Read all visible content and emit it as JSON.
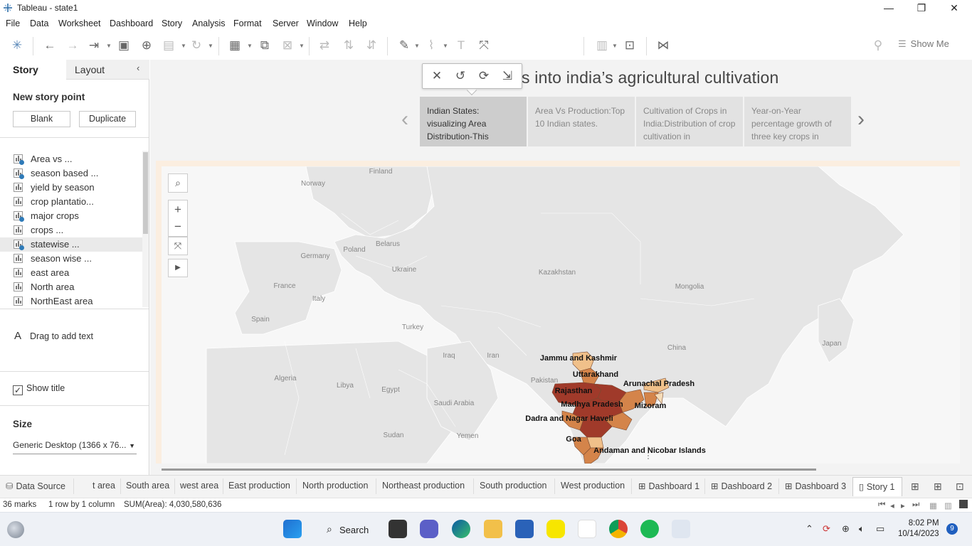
{
  "window": {
    "title": "Tableau - state1",
    "minimize": "—",
    "restore": "❐",
    "close": "✕"
  },
  "menu": [
    "File",
    "Data",
    "Worksheet",
    "Dashboard",
    "Story",
    "Analysis",
    "Format",
    "Server",
    "Window",
    "Help"
  ],
  "toolbar": {
    "show_me_label": "Show Me"
  },
  "left_panel": {
    "tabs": {
      "story": "Story",
      "layout": "Layout"
    },
    "new_story_point": "New story point",
    "blank_button": "Blank",
    "duplicate_button": "Duplicate",
    "sheets": [
      {
        "label": "Area vs ...",
        "type": "dashboard"
      },
      {
        "label": "season based ...",
        "type": "dashboard"
      },
      {
        "label": "yield by season",
        "type": "sheet"
      },
      {
        "label": "crop plantatio...",
        "type": "sheet"
      },
      {
        "label": "major crops",
        "type": "dashboard"
      },
      {
        "label": "crops ...",
        "type": "sheet"
      },
      {
        "label": "statewise ...",
        "type": "dashboard",
        "selected": true
      },
      {
        "label": "season wise ...",
        "type": "sheet"
      },
      {
        "label": "east area",
        "type": "sheet"
      },
      {
        "label": "North area",
        "type": "sheet"
      },
      {
        "label": "NorthEast area",
        "type": "sheet"
      }
    ],
    "drag_to_add_text": "Drag to add text",
    "drag_icon": "A",
    "show_title": "Show title",
    "size_header": "Size",
    "size_value": "Generic Desktop (1366 x 76..."
  },
  "story": {
    "title": "s into india’s agricultural cultivation",
    "points": [
      {
        "text": "Indian States: visualizing Area Distribution-This",
        "active": true
      },
      {
        "text": "Area Vs Production:Top 10 Indian states.",
        "active": false
      },
      {
        "text": "Cultivation of Crops in India:Distribution of crop cultivation in",
        "active": false
      },
      {
        "text": "Year-on-Year percentage growth of three key crops in",
        "active": false
      }
    ]
  },
  "map": {
    "country_labels": [
      "Finland",
      "Norway",
      "Poland",
      "Belarus",
      "Germany",
      "Ukraine",
      "France",
      "Kazakhstan",
      "Mongolia",
      "Italy",
      "Spain",
      "Turkey",
      "Iraq",
      "Iran",
      "China",
      "Japan",
      "Algeria",
      "Libya",
      "Egypt",
      "Pakistan",
      "Saudi Arabia",
      "Yemen",
      "Sudan"
    ],
    "state_labels": [
      "Jammu and Kashmir",
      "Uttarakhand",
      "Arunachal Pradesh",
      "Rajasthan",
      "Madhya Pradesh",
      "Mizoram",
      "Dadra and Nagar Haveli",
      "Goa",
      "Andaman and Nicobar Islands"
    ],
    "colors": {
      "dark": "#a03a2a",
      "mid": "#d4844a",
      "light": "#f0c08a",
      "pale": "#f6dcb8"
    }
  },
  "sheet_tabs": [
    "Data Source",
    "t area",
    "South area",
    "west area",
    "East production",
    "North production",
    "Northeast production",
    "South production",
    "West production",
    "Dashboard 1",
    "Dashboard 2",
    "Dashboard 3",
    "Story 1"
  ],
  "status": {
    "marks": "36 marks",
    "rows_cols": "1 row by 1 column",
    "sum": "SUM(Area): 4,030,580,636"
  },
  "taskbar": {
    "search_label": "Search",
    "time": "8:02 PM",
    "date": "10/14/2023",
    "notification_count": "9"
  }
}
